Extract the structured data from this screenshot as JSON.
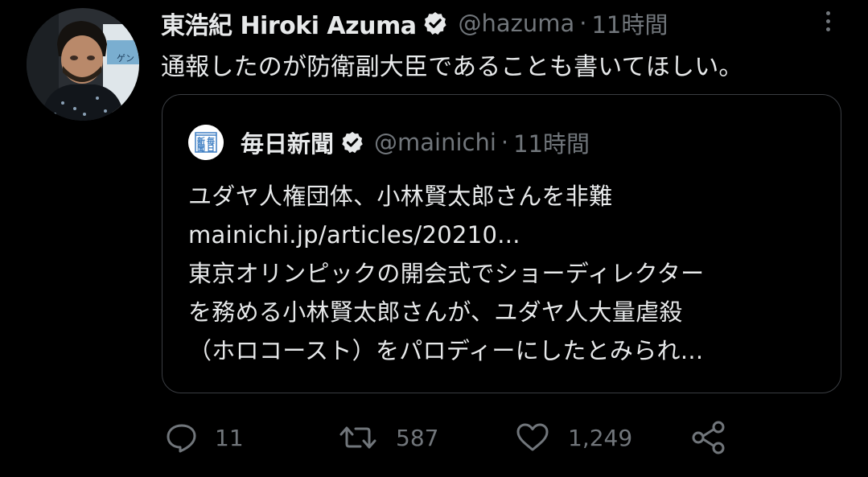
{
  "tweet": {
    "author_name": "東浩紀 Hiroki Azuma",
    "handle": "@hazuma",
    "separator": "·",
    "time": "11時間",
    "text": "通報したのが防衛副大臣であることも書いてほしい。",
    "avatar_sign_text": "ゲン"
  },
  "quoted": {
    "author_name": "毎日新聞",
    "handle": "@mainichi",
    "separator": "·",
    "time": "11時間",
    "logo_text": [
      "新",
      "毎",
      "聞",
      "日"
    ],
    "lines": [
      "ユダヤ人権団体、小林賢太郎さんを非難",
      "mainichi.jp/articles/20210...",
      "東京オリンピックの開会式でショーディレクター",
      "を務める小林賢太郎さんが、ユダヤ人大量虐殺",
      "（ホロコースト）をパロディーにしたとみられ..."
    ]
  },
  "actions": {
    "replies": "11",
    "retweets": "587",
    "likes": "1,249"
  },
  "icons": {
    "reply": "reply-icon",
    "retweet": "retweet-icon",
    "like": "heart-icon",
    "share": "share-icon",
    "verified": "verified-badge-icon",
    "more": "more-options-icon"
  },
  "colors": {
    "background": "#000000",
    "text_primary": "#e7e9ea",
    "text_secondary": "#71767b",
    "card_border": "#3a3d42",
    "logo_blue": "#3f7fc3"
  }
}
